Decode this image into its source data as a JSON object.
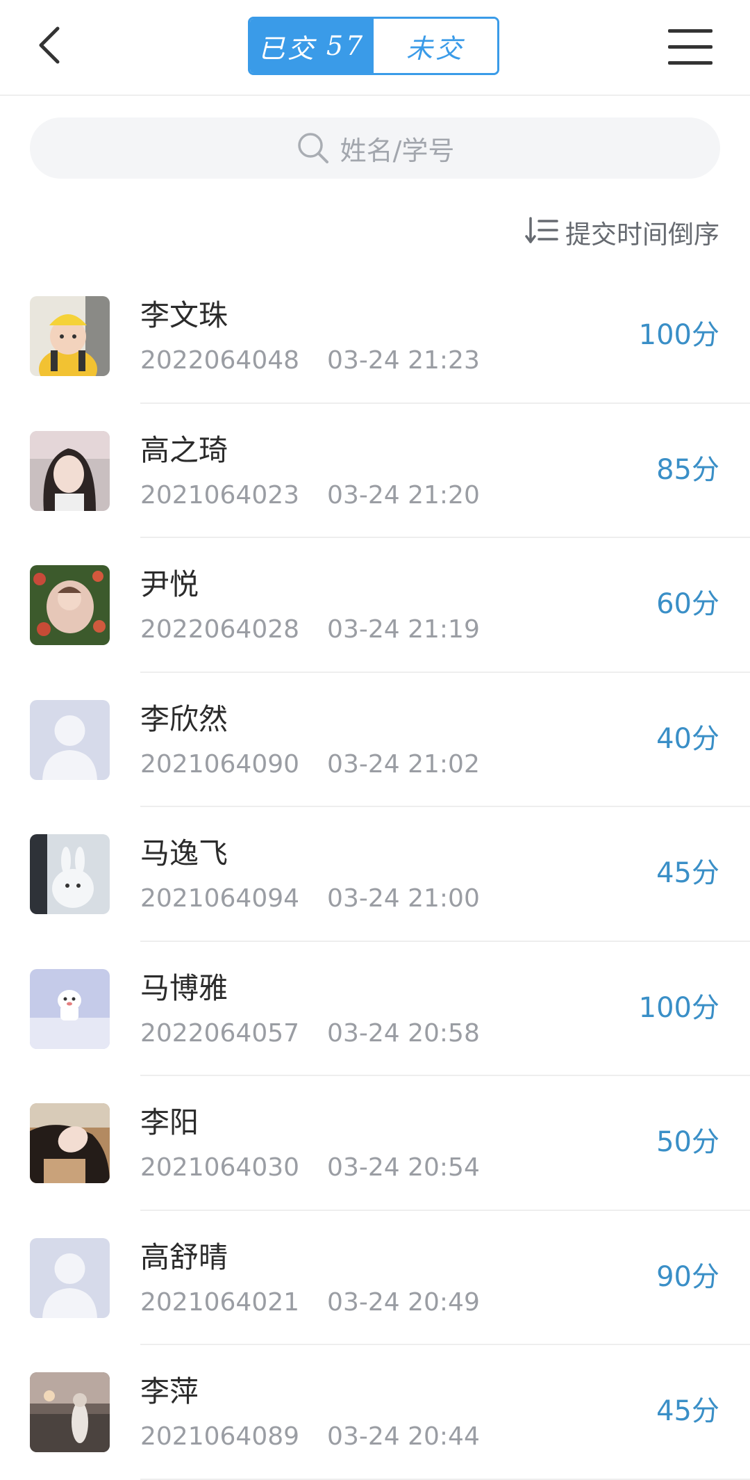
{
  "header": {
    "tab_submitted_label": "已交",
    "tab_submitted_count": "57",
    "tab_unsubmitted_label": "未交"
  },
  "search": {
    "placeholder": "姓名/学号"
  },
  "sort": {
    "label": "提交时间倒序"
  },
  "colors": {
    "accent": "#3a9be8",
    "score": "#3a8fc7"
  },
  "students": [
    {
      "name": "李文珠",
      "id": "2022064048",
      "time": "03-24 21:23",
      "score": "100分",
      "avatar": "photo-child-yellow-hat"
    },
    {
      "name": "高之琦",
      "id": "2021064023",
      "time": "03-24 21:20",
      "score": "85分",
      "avatar": "photo-girl-portrait"
    },
    {
      "name": "尹悦",
      "id": "2022064028",
      "time": "03-24 21:19",
      "score": "60分",
      "avatar": "photo-girl-flowers"
    },
    {
      "name": "李欣然",
      "id": "2021064090",
      "time": "03-24 21:02",
      "score": "40分",
      "avatar": "default-avatar"
    },
    {
      "name": "马逸飞",
      "id": "2021064094",
      "time": "03-24 21:00",
      "score": "45分",
      "avatar": "photo-snow-rabbit"
    },
    {
      "name": "马博雅",
      "id": "2022064057",
      "time": "03-24 20:58",
      "score": "100分",
      "avatar": "photo-cartoon-blue"
    },
    {
      "name": "李阳",
      "id": "2021064030",
      "time": "03-24 20:54",
      "score": "50分",
      "avatar": "photo-girl-lying"
    },
    {
      "name": "高舒晴",
      "id": "2021064021",
      "time": "03-24 20:49",
      "score": "90分",
      "avatar": "default-avatar"
    },
    {
      "name": "李萍",
      "id": "2021064089",
      "time": "03-24 20:44",
      "score": "45分",
      "avatar": "photo-beach-sunset"
    }
  ]
}
